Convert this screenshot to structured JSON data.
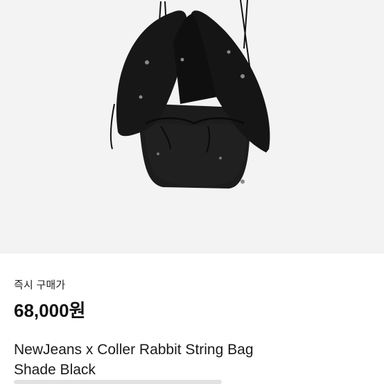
{
  "product": {
    "image_alt_icon": "product-photo-black-rabbit-backpack",
    "sale_type": "즉시 구매가",
    "price": "68,000원",
    "title_line1": "NewJeans x Coller Rabbit String Bag",
    "title_line2": "Shade Black"
  },
  "colors": {
    "photo_background": "#f3f3f3",
    "bag": "#1b1b1b",
    "text_primary": "#111111"
  }
}
